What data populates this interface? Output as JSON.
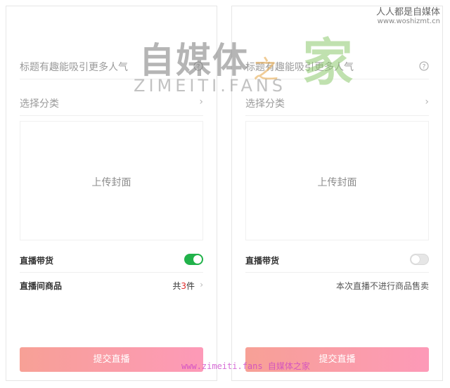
{
  "watermark": {
    "brand": "自媒体",
    "brand_home": "家",
    "brand_swoosh": "之",
    "sub": "ZIMEITI.FANS",
    "corner_title": "人人都是自媒体",
    "corner_url": "www.woshizmt.cn",
    "bottom": "www.zimeiti.fans 自媒体之家"
  },
  "panels": [
    {
      "title_placeholder": "标题有趣能吸引更多人气",
      "category_label": "选择分类",
      "chevron": "›",
      "cover_label": "上传封面",
      "live_sale_label": "直播带货",
      "live_sale_on": true,
      "goods_label": "直播间商品",
      "goods_prefix": "共",
      "goods_count": "3",
      "goods_suffix": "件",
      "submit_label": "提交直播"
    },
    {
      "title_placeholder": "标题有趣能吸引更多人气",
      "category_label": "选择分类",
      "chevron": "›",
      "cover_label": "上传封面",
      "live_sale_label": "直播带货",
      "live_sale_on": false,
      "goods_label": "直播间商品",
      "no_sale_note": "本次直播不进行商品售卖",
      "submit_label": "提交直播"
    }
  ],
  "colors": {
    "toggle_on": "#21b24a",
    "submit_start": "#f7a096",
    "submit_end": "#fd9ab8",
    "count_highlight": "#e02a2a"
  }
}
